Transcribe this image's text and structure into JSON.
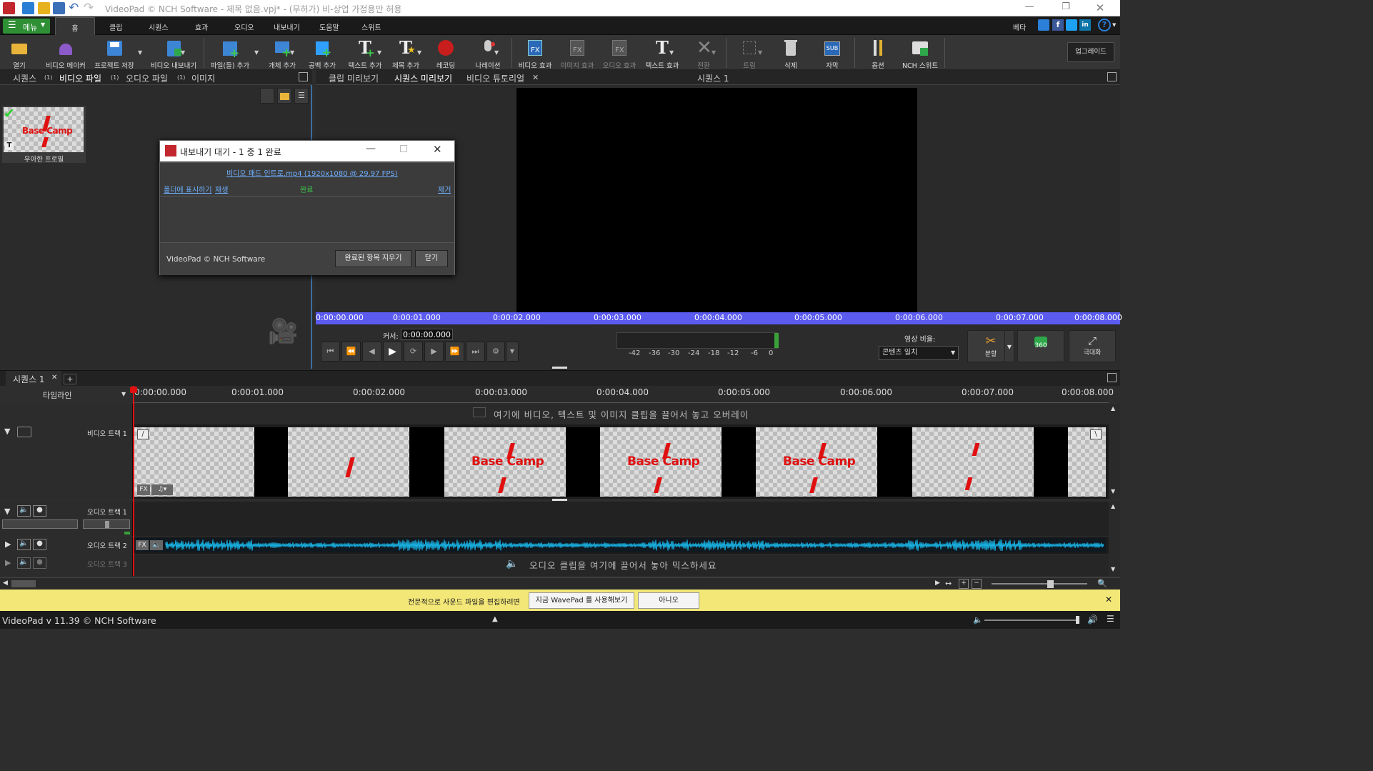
{
  "window": {
    "title": "VideoPad © NCH Software - 제목 없음.vpj* - (무허가) 비-상업 가정용만 허용"
  },
  "menu": {
    "menu_button": "메뉴",
    "tabs": [
      "홈",
      "클립",
      "시퀀스",
      "효과",
      "오디오",
      "내보내기",
      "도움말",
      "스위트"
    ],
    "beta": "베타"
  },
  "toolbar": {
    "items": [
      {
        "label": "열기",
        "icon": "open-folder-icon"
      },
      {
        "label": "비디오 메이커",
        "icon": "video-maker-icon"
      },
      {
        "label": "프로젝트 저장",
        "icon": "save-project-icon"
      },
      {
        "label": "비디오 내보내기",
        "icon": "export-video-icon"
      },
      {
        "label": "파일(들) 추가",
        "icon": "add-files-icon"
      },
      {
        "label": "개체 추가",
        "icon": "add-object-icon"
      },
      {
        "label": "공백 추가",
        "icon": "add-blank-icon"
      },
      {
        "label": "텍스트 추가",
        "icon": "add-text-icon"
      },
      {
        "label": "제목 추가",
        "icon": "add-title-icon"
      },
      {
        "label": "레코딩",
        "icon": "record-icon"
      },
      {
        "label": "나레이션",
        "icon": "narration-mic-icon"
      },
      {
        "label": "비디오 효과",
        "icon": "video-fx-icon"
      },
      {
        "label": "이미지 효과",
        "icon": "image-fx-icon"
      },
      {
        "label": "오디오 효과",
        "icon": "audio-fx-icon"
      },
      {
        "label": "텍스트 효과",
        "icon": "text-fx-icon"
      },
      {
        "label": "전환",
        "icon": "transition-icon"
      },
      {
        "label": "트림",
        "icon": "trim-icon"
      },
      {
        "label": "삭제",
        "icon": "delete-trash-icon"
      },
      {
        "label": "자막",
        "icon": "subtitle-icon"
      },
      {
        "label": "옵션",
        "icon": "options-tools-icon"
      },
      {
        "label": "NCH 스위트",
        "icon": "nch-suite-icon"
      }
    ],
    "upgrade": "업그레이드"
  },
  "bin": {
    "tabs": [
      {
        "label": "시퀀스",
        "count": "(1)"
      },
      {
        "label": "비디오 파일",
        "count": "(1)"
      },
      {
        "label": "오디오 파일",
        "count": "(1)"
      },
      {
        "label": "이미지",
        "count": ""
      }
    ],
    "clip": {
      "name": "우아한 프로필",
      "thumb_text": "Base Camp"
    }
  },
  "preview": {
    "tabs": [
      "클립 미리보기",
      "시퀀스 미리보기",
      "비디오 튜토리얼"
    ],
    "sequence_title": "시퀀스 1",
    "ruler": [
      "0:00:00.000",
      "0:00:01.000",
      "0:00:02.000",
      "0:00:03.000",
      "0:00:04.000",
      "0:00:05.000",
      "0:00:06.000",
      "0:00:07.000",
      "0:00:08.000"
    ],
    "cursor_label": "커서:",
    "cursor_value": "0:00:00.000",
    "meter_ticks": [
      "-42",
      "-36",
      "-30",
      "-24",
      "-18",
      "-12",
      "-6",
      "0"
    ],
    "ratio_label": "영상 비율:",
    "ratio_value": "콘텐츠 일치",
    "split_label": "분할",
    "vr_label": "360",
    "fullscreen_label": "극대화"
  },
  "dialog": {
    "title": "내보내기 대기 - 1 중 1 완료",
    "file": "비디오 패드 인트로.mp4 (1920x1080 @ 29.97 FPS)",
    "show_folder": "폴더에 표시하기",
    "play": "재생",
    "status": "완료",
    "remove": "제거",
    "footer": "VideoPad © NCH Software",
    "clear": "완료된 항목 지우기",
    "close": "닫기"
  },
  "timeline": {
    "seq_tab": "시퀀스 1",
    "mode": "타임라인",
    "ruler": [
      "0:00:00.000",
      "0:00:01.000",
      "0:00:02.000",
      "0:00:03.000",
      "0:00:04.000",
      "0:00:05.000",
      "0:00:06.000",
      "0:00:07.000",
      "0:00:08.000"
    ],
    "overlay_hint": "여기에 비디오, 텍스트 및 이미지 클립을 끌어서 놓고 오버레이",
    "video_track": "비디오 트랙 1",
    "audio1": "오디오 트랙 1",
    "audio2": "오디오 트랙 2",
    "audio3": "오디오 트랙 3",
    "audio_hint": "오디오 클립을 여기에 끌어서 놓아 믹스하세요",
    "frames": [
      {
        "text": "",
        "slash": true
      },
      {
        "text": "Base Camp",
        "slash": true
      },
      {
        "text": "Base Camp",
        "slash": true
      },
      {
        "text": "Base Camp",
        "slash": true
      },
      {
        "text": "",
        "slash": true
      }
    ]
  },
  "promo": {
    "text": "전문적으로 사운드 파일을 편집하려면",
    "yes": "지금 WavePad 를 사용해보기",
    "no": "아니오"
  },
  "status": {
    "version": "VideoPad v 11.39 © NCH Software"
  },
  "colors": {
    "accent_green": "#2e8f35",
    "ruler_blue": "#5b5bf0",
    "clip_red": "#e01010",
    "wave_cyan": "#19b5e6",
    "promo_yellow": "#f3e777"
  }
}
